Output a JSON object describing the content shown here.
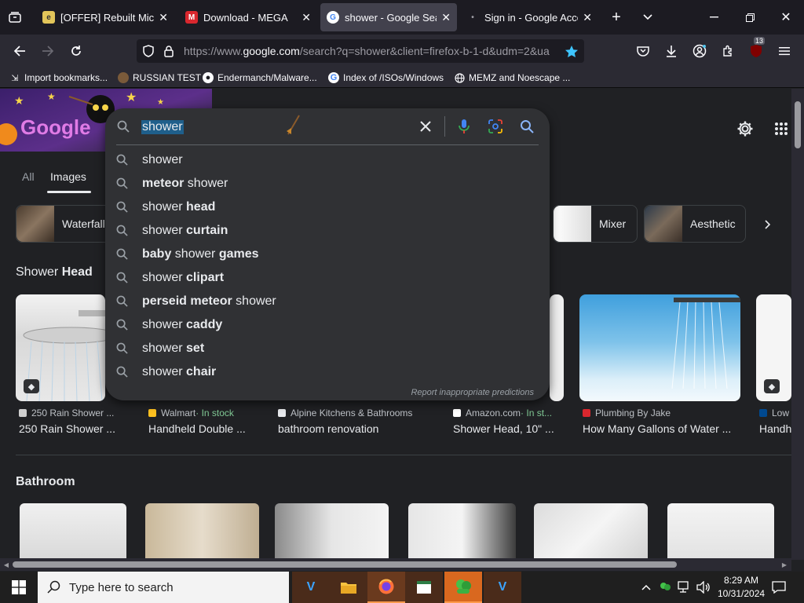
{
  "browser": {
    "tabs": [
      {
        "title": "[OFFER] Rebuilt Microsoft",
        "active": false
      },
      {
        "title": "Download - MEGA",
        "active": false
      },
      {
        "title": "shower - Google Search",
        "active": true
      },
      {
        "title": "Sign in - Google Accounts",
        "active": false
      }
    ],
    "url_prefix": "https://www.",
    "url_domain": "google.com",
    "url_rest": "/search?q=shower&client=firefox-b-1-d&udm=2&ua",
    "extensions_badge": "13",
    "bookmarks": [
      {
        "label": "Import bookmarks...",
        "icon": "import-icon"
      },
      {
        "label": "RUSSIAN TEST",
        "icon": "avatar-icon"
      },
      {
        "label": "Endermanch/Malware...",
        "icon": "github-icon"
      },
      {
        "label": "Index of /ISOs/Windows",
        "icon": "google-icon"
      },
      {
        "label": "MEMZ and Noescape ...",
        "icon": "globe-icon"
      }
    ]
  },
  "search": {
    "query": "shower",
    "suggestions": [
      {
        "pre": "",
        "normal": "shower",
        "bold": ""
      },
      {
        "pre": "meteor",
        "normal": " shower",
        "bold": ""
      },
      {
        "pre": "",
        "normal": "shower ",
        "bold": "head"
      },
      {
        "pre": "",
        "normal": "shower ",
        "bold": "curtain"
      },
      {
        "pre": "baby",
        "normal": " shower ",
        "bold": "games"
      },
      {
        "pre": "",
        "normal": "shower ",
        "bold": "clipart"
      },
      {
        "pre": "perseid meteor",
        "normal": " shower",
        "bold": ""
      },
      {
        "pre": "",
        "normal": "shower ",
        "bold": "caddy"
      },
      {
        "pre": "",
        "normal": "shower ",
        "bold": "set"
      },
      {
        "pre": "",
        "normal": "shower ",
        "bold": "chair"
      }
    ],
    "report_text": "Report inappropriate predictions"
  },
  "page": {
    "filters": [
      "All",
      "Images"
    ],
    "active_filter": "Images",
    "chips": [
      "Waterfall",
      "Mixer",
      "Aesthetic"
    ],
    "section1_title_a": "Shower ",
    "section1_title_b": "Head",
    "results": [
      {
        "source": "250 Rain Shower ...",
        "stock": "",
        "title": "250 Rain Shower ..."
      },
      {
        "source": "Walmart",
        "stock": " · In stock",
        "title": "Handheld Double ..."
      },
      {
        "source": "Alpine Kitchens & Bathrooms",
        "stock": "",
        "title": "bathroom renovation"
      },
      {
        "source": "Amazon.com",
        "stock": " · In st...",
        "title": "Shower Head, 10\" ..."
      },
      {
        "source": "Plumbing By Jake",
        "stock": "",
        "title": "How Many Gallons of Water ..."
      },
      {
        "source": "Low",
        "stock": "",
        "title": "Handh"
      }
    ],
    "section2_title": "Bathroom"
  },
  "taskbar": {
    "search_placeholder": "Type here to search",
    "time": "8:29 AM",
    "date": "10/31/2024"
  },
  "colors": {
    "accent_blue": "#8ab4f8",
    "selection": "#1f5f8b",
    "in_stock": "#81c995"
  }
}
